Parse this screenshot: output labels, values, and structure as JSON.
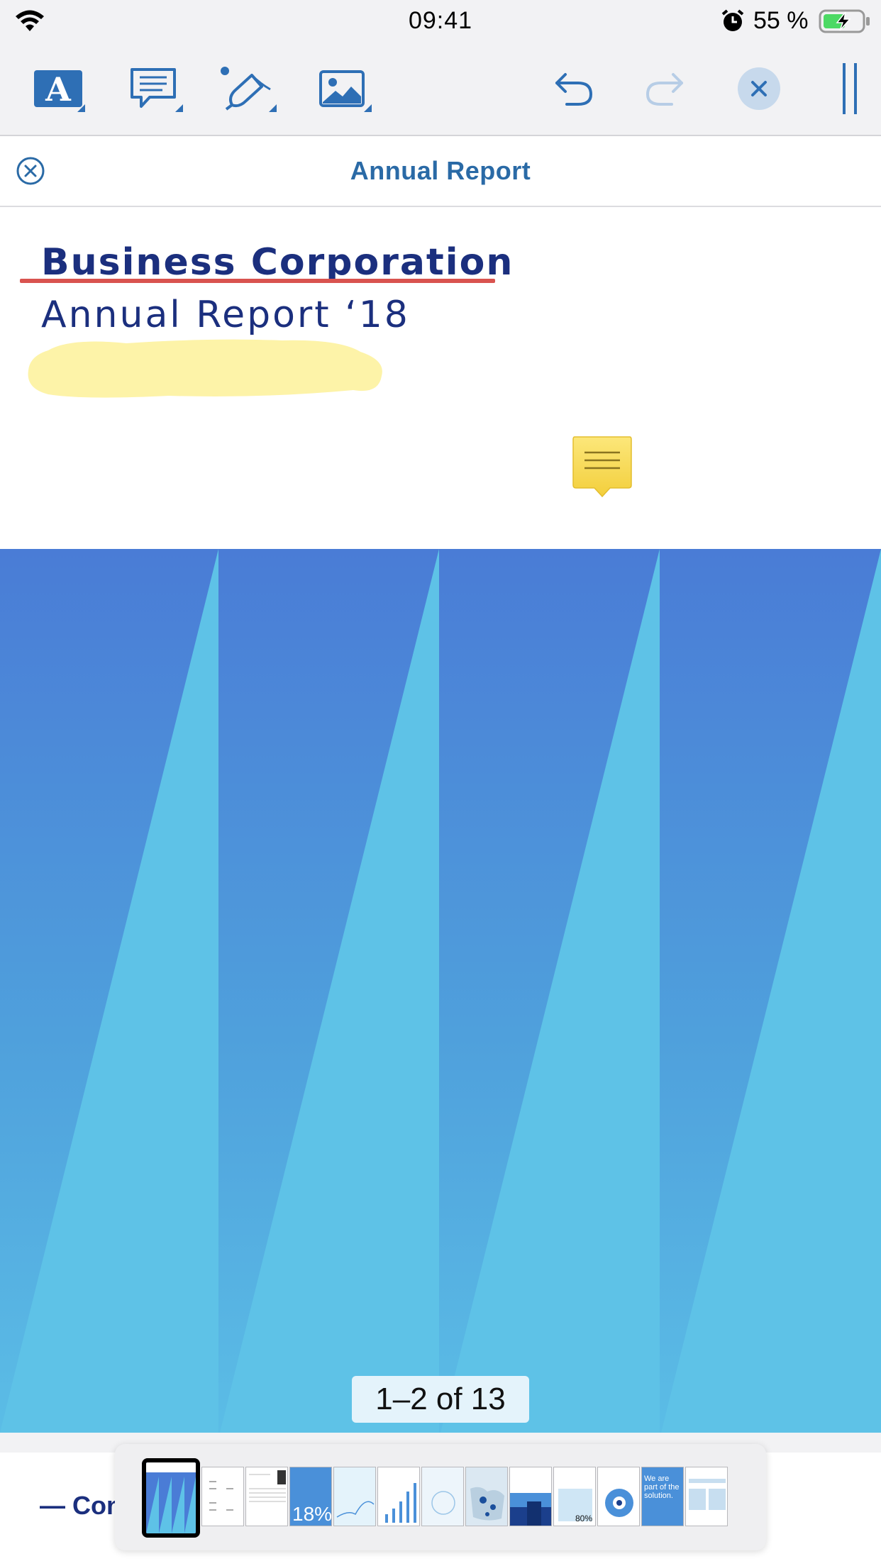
{
  "status_bar": {
    "time": "09:41",
    "battery_percent": "55 %",
    "icons": [
      "wifi-icon",
      "alarm-icon",
      "battery-charging-icon"
    ]
  },
  "toolbar": {
    "tools": [
      "text-tool-icon",
      "comment-tool-icon",
      "draw-tool-icon",
      "image-tool-icon"
    ],
    "actions": [
      "undo-icon",
      "redo-icon",
      "close-icon",
      "more-icon"
    ],
    "accent_color": "#2e6fb5"
  },
  "document": {
    "title": "Annual Report",
    "company": "Business Corporation",
    "subtitle": "Annual Report ‘18",
    "annotation_colors": {
      "underline": "#d9534f",
      "highlight": "#fdf3a8",
      "note": "#f8d84a"
    }
  },
  "pager": {
    "label": "1–2 of 13"
  },
  "bottom": {
    "contents_text": "— Con"
  },
  "thumbnails": {
    "selected_index": 0,
    "items": [
      {
        "name": "cover",
        "text": ""
      },
      {
        "name": "contents",
        "text": ""
      },
      {
        "name": "letter",
        "text": ""
      },
      {
        "name": "highlights",
        "text": "18%"
      },
      {
        "name": "performance",
        "text": ""
      },
      {
        "name": "revenue-chart",
        "text": ""
      },
      {
        "name": "strategy",
        "text": ""
      },
      {
        "name": "map",
        "text": ""
      },
      {
        "name": "markets",
        "text": ""
      },
      {
        "name": "share",
        "text": "80%"
      },
      {
        "name": "sustainability",
        "text": ""
      },
      {
        "name": "solution",
        "text": "We are part of the solution."
      },
      {
        "name": "financials",
        "text": ""
      }
    ]
  }
}
